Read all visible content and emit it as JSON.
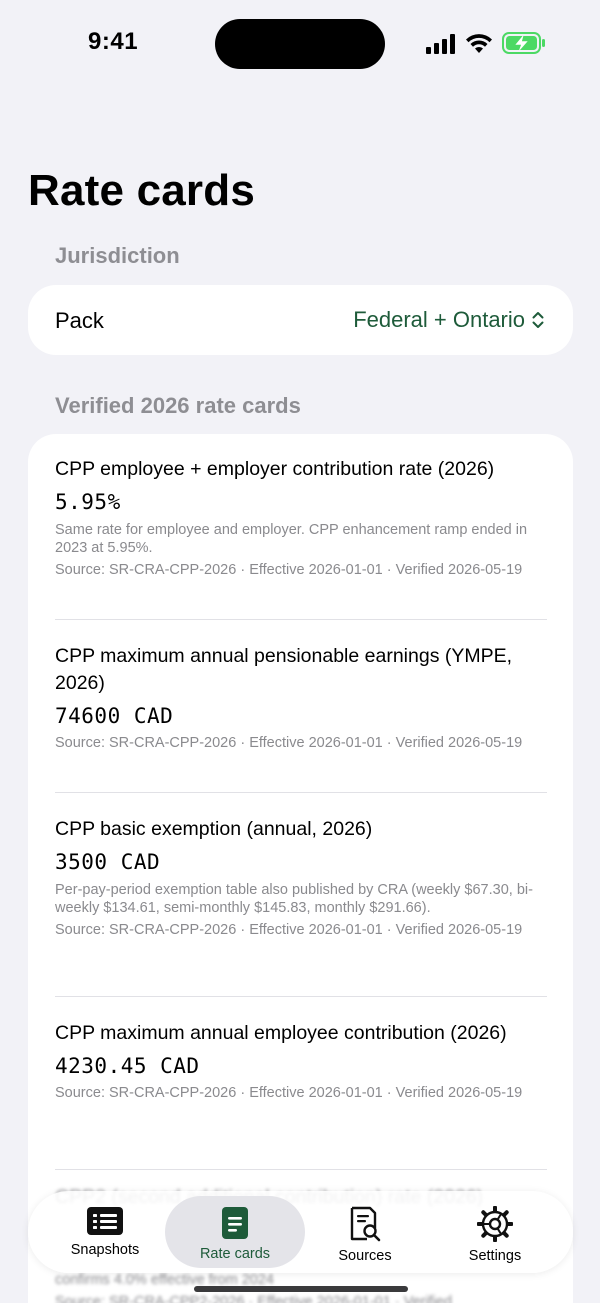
{
  "status_bar": {
    "time": "9:41"
  },
  "page": {
    "title": "Rate cards"
  },
  "jurisdiction": {
    "section_label": "Jurisdiction",
    "pack_label": "Pack",
    "pack_value": "Federal + Ontario"
  },
  "rate_cards": {
    "section_label": "Verified 2026 rate cards",
    "items": [
      {
        "title": "CPP employee + employer contribution rate (2026)",
        "value": "5.95%",
        "note": "Same rate for employee and employer. CPP enhancement ramp ended in 2023 at 5.95%.",
        "source": "Source: SR-CRA-CPP-2026  ·  Effective 2026-01-01  ·  Verified 2026-05-19"
      },
      {
        "title": "CPP maximum annual pensionable earnings (YMPE, 2026)",
        "value": "74600 CAD",
        "note": "",
        "source": "Source: SR-CRA-CPP-2026  ·  Effective 2026-01-01  ·  Verified 2026-05-19"
      },
      {
        "title": "CPP basic exemption (annual, 2026)",
        "value": "3500 CAD",
        "note": "Per-pay-period exemption table also published by CRA (weekly $67.30, bi-weekly $134.61, semi-monthly $145.83, monthly $291.66).",
        "source": "Source: SR-CRA-CPP-2026  ·  Effective 2026-01-01  ·  Verified 2026-05-19"
      },
      {
        "title": "CPP maximum annual employee contribution (2026)",
        "value": "4230.45 CAD",
        "note": "",
        "source": "Source: SR-CRA-CPP-2026  ·  Effective 2026-01-01  ·  Verified 2026-05-19"
      }
    ],
    "partial_item": {
      "title": "CPP2 (second additional contribution) rate (2026)",
      "note": "confirms 4.0% effective from 2024",
      "source": "Source: SR-CRA-CPP2-2026  ·  Effective 2026-01-01  ·  Verified"
    }
  },
  "tab_bar": {
    "tabs": [
      {
        "label": "Snapshots",
        "icon": "snapshots-icon"
      },
      {
        "label": "Rate cards",
        "icon": "rate-cards-icon",
        "active": true
      },
      {
        "label": "Sources",
        "icon": "sources-icon"
      },
      {
        "label": "Settings",
        "icon": "settings-icon"
      }
    ]
  },
  "colors": {
    "accent": "#1E5B3A",
    "background": "#F2F2F7",
    "secondary_text": "#8A8A8E"
  }
}
